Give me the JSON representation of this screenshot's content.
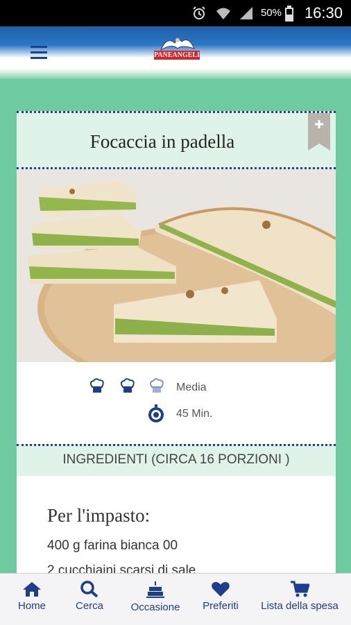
{
  "status_bar": {
    "battery": "50%",
    "time": "16:30",
    "icons": [
      "alarm-icon",
      "wifi-icon",
      "signal-icon",
      "battery-icon"
    ]
  },
  "app_bar": {
    "menu_icon": "hamburger-menu-icon",
    "logo_text": "PANEANGELI"
  },
  "recipe": {
    "title": "Focaccia in padella",
    "difficulty": "Media",
    "difficulty_level": 2,
    "difficulty_max": 3,
    "time": "45 Min.",
    "ingredients_header": "INGREDIENTI (CIRCA 16 PORZIONI )",
    "section_title": "Per l'impasto:",
    "ingredients": [
      "400 g farina bianca 00",
      "2 cucchiaini scarsi di sale"
    ]
  },
  "bottom_nav": [
    {
      "label": "Home",
      "icon": "home-icon"
    },
    {
      "label": "Cerca",
      "icon": "search-icon"
    },
    {
      "label": "Occasione",
      "icon": "cake-icon"
    },
    {
      "label": "Preferiti",
      "icon": "heart-icon"
    },
    {
      "label": "Lista della spesa",
      "icon": "cart-icon"
    }
  ],
  "colors": {
    "brand_blue": "#1d3d8f",
    "mint": "#6ecba0",
    "pale_mint": "#dff3e8"
  }
}
